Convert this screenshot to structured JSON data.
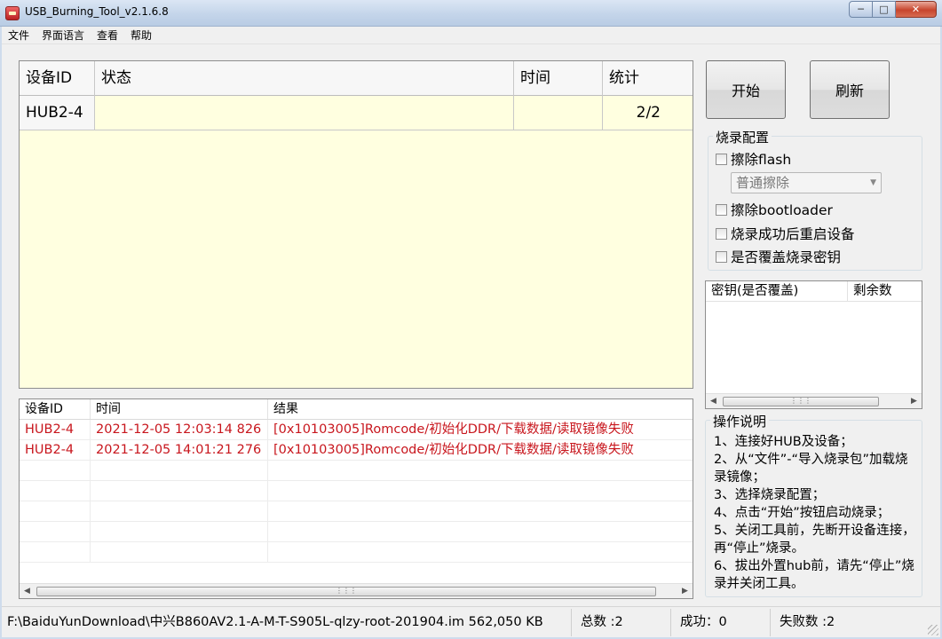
{
  "window": {
    "title": "USB_Burning_Tool_v2.1.6.8"
  },
  "menu": [
    "文件",
    "界面语言",
    "查看",
    "帮助"
  ],
  "device_grid": {
    "headers": [
      "设备ID",
      "状态",
      "时间",
      "统计"
    ],
    "rows": [
      {
        "id": "HUB2-4",
        "status": "",
        "time": "",
        "count": "2/2"
      }
    ]
  },
  "buttons": {
    "start": "开始",
    "refresh": "刷新"
  },
  "burn_config": {
    "title": "烧录配置",
    "erase_flash": "擦除flash",
    "erase_mode": "普通擦除",
    "erase_bootloader": "擦除bootloader",
    "reboot_after": "烧录成功后重启设备",
    "overwrite_key": "是否覆盖烧录密钥"
  },
  "key_list": {
    "headers": [
      "密钥(是否覆盖)",
      "剩余数"
    ]
  },
  "log": {
    "headers": [
      "设备ID",
      "时间",
      "结果"
    ],
    "rows": [
      {
        "id": "HUB2-4",
        "time": "2021-12-05 12:03:14 826",
        "result": "[0x10103005]Romcode/初始化DDR/下载数据/读取镜像失败"
      },
      {
        "id": "HUB2-4",
        "time": "2021-12-05 14:01:21 276",
        "result": "[0x10103005]Romcode/初始化DDR/下载数据/读取镜像失败"
      }
    ]
  },
  "instructions": {
    "title": "操作说明",
    "lines": [
      "1、连接好HUB及设备；",
      "2、从“文件”-“导入烧录包”加载烧录镜像；",
      "3、选择烧录配置；",
      "4、点击“开始”按钮启动烧录；",
      "5、关闭工具前，先断开设备连接，再“停止”烧录。",
      "6、拔出外置hub前，请先“停止”烧录并关闭工具。"
    ]
  },
  "status_bar": {
    "file": "F:\\BaiduYunDownload\\中兴B860AV2.1-A-M-T-S905L-qlzy-root-201904.im 562,050 KB",
    "total": "总数 :2",
    "success": "成功：0",
    "fail": "失败数 :2"
  }
}
